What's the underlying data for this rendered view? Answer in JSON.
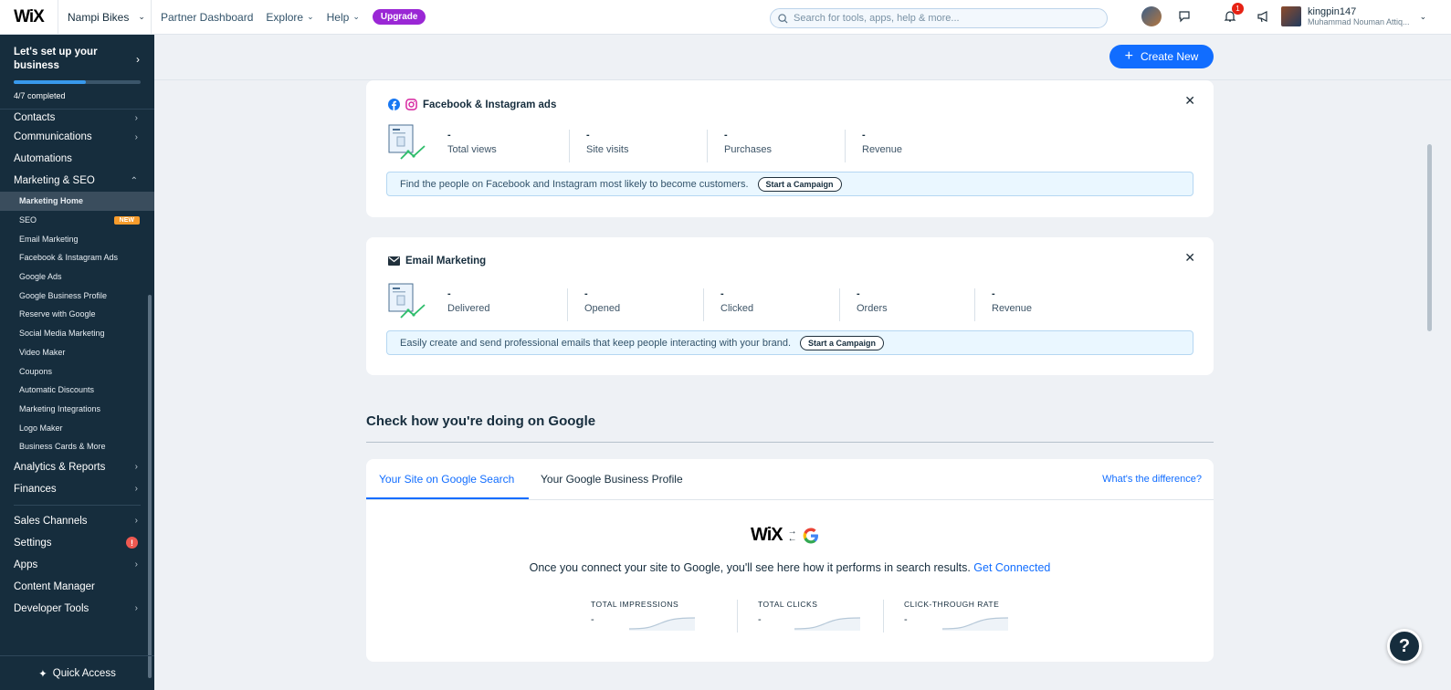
{
  "topbar": {
    "logo": "WiX",
    "site_name": "Nampi Bikes",
    "links": [
      "Partner Dashboard",
      "Explore",
      "Help"
    ],
    "upgrade": "Upgrade",
    "search_placeholder": "Search for tools, apps, help & more...",
    "notification_count": "1",
    "user_name": "kingpin147",
    "user_full": "Muhammad Nouman Attiq..."
  },
  "sidebar": {
    "setup_title": "Let's set up your business",
    "setup_progress": 0.57,
    "setup_status": "4/7 completed",
    "items_top": [
      "Contacts",
      "Communications",
      "Automations"
    ],
    "marketing": "Marketing & SEO",
    "sub": [
      "Marketing Home",
      "SEO",
      "Email Marketing",
      "Facebook & Instagram Ads",
      "Google Ads",
      "Google Business Profile",
      "Reserve with Google",
      "Social Media Marketing",
      "Video Maker",
      "Coupons",
      "Automatic Discounts",
      "Marketing Integrations",
      "Logo Maker",
      "Business Cards & More"
    ],
    "new_tag": "NEW",
    "items_mid": [
      "Analytics & Reports",
      "Finances"
    ],
    "items_bottom": [
      "Sales Channels",
      "Settings",
      "Apps",
      "Content Manager",
      "Developer Tools"
    ],
    "quick_access": "Quick Access"
  },
  "main": {
    "create_new": "Create New",
    "fb_card": {
      "title": "Facebook & Instagram ads",
      "metrics": [
        {
          "value": "-",
          "label": "Total views"
        },
        {
          "value": "-",
          "label": "Site visits"
        },
        {
          "value": "-",
          "label": "Purchases"
        },
        {
          "value": "-",
          "label": "Revenue"
        }
      ],
      "banner": "Find the people on Facebook and Instagram most likely to become customers.",
      "button": "Start a Campaign"
    },
    "email_card": {
      "title": "Email Marketing",
      "metrics": [
        {
          "value": "-",
          "label": "Delivered"
        },
        {
          "value": "-",
          "label": "Opened"
        },
        {
          "value": "-",
          "label": "Clicked"
        },
        {
          "value": "-",
          "label": "Orders"
        },
        {
          "value": "-",
          "label": "Revenue"
        }
      ],
      "banner": "Easily create and send professional emails that keep people interacting with your brand.",
      "button": "Start a Campaign"
    },
    "google": {
      "heading": "Check how you're doing on Google",
      "tabs": [
        "Your Site on Google Search",
        "Your Google Business Profile"
      ],
      "difference": "What's the difference?",
      "wix": "WiX",
      "text": "Once you connect your site to Google, you'll see here how it performs in search results.",
      "link": "Get Connected",
      "stats": [
        {
          "label": "TOTAL IMPRESSIONS",
          "value": "-"
        },
        {
          "label": "TOTAL CLICKS",
          "value": "-"
        },
        {
          "label": "CLICK-THROUGH RATE",
          "value": "-"
        }
      ]
    },
    "help": "?"
  }
}
